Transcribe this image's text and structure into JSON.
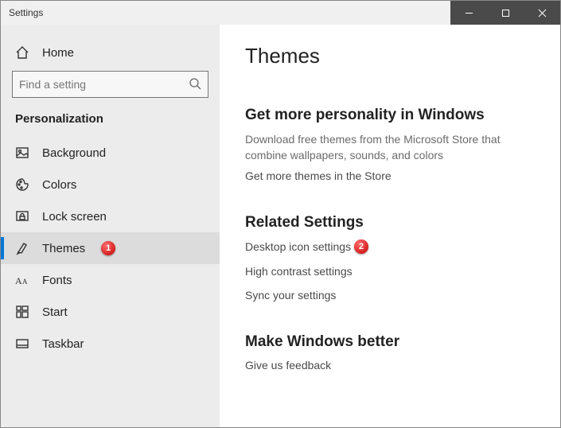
{
  "window": {
    "title": "Settings"
  },
  "sidebar": {
    "home": "Home",
    "search_placeholder": "Find a setting",
    "section": "Personalization",
    "items": [
      {
        "label": "Background"
      },
      {
        "label": "Colors"
      },
      {
        "label": "Lock screen"
      },
      {
        "label": "Themes",
        "selected": true,
        "marker": "1"
      },
      {
        "label": "Fonts"
      },
      {
        "label": "Start"
      },
      {
        "label": "Taskbar"
      }
    ]
  },
  "main": {
    "title": "Themes",
    "personality": {
      "heading": "Get more personality in Windows",
      "desc": "Download free themes from the Microsoft Store that combine wallpapers, sounds, and colors",
      "link": "Get more themes in the Store"
    },
    "related": {
      "heading": "Related Settings",
      "links": [
        {
          "label": "Desktop icon settings",
          "marker": "2"
        },
        {
          "label": "High contrast settings"
        },
        {
          "label": "Sync your settings"
        }
      ]
    },
    "better": {
      "heading": "Make Windows better",
      "link": "Give us feedback"
    }
  }
}
